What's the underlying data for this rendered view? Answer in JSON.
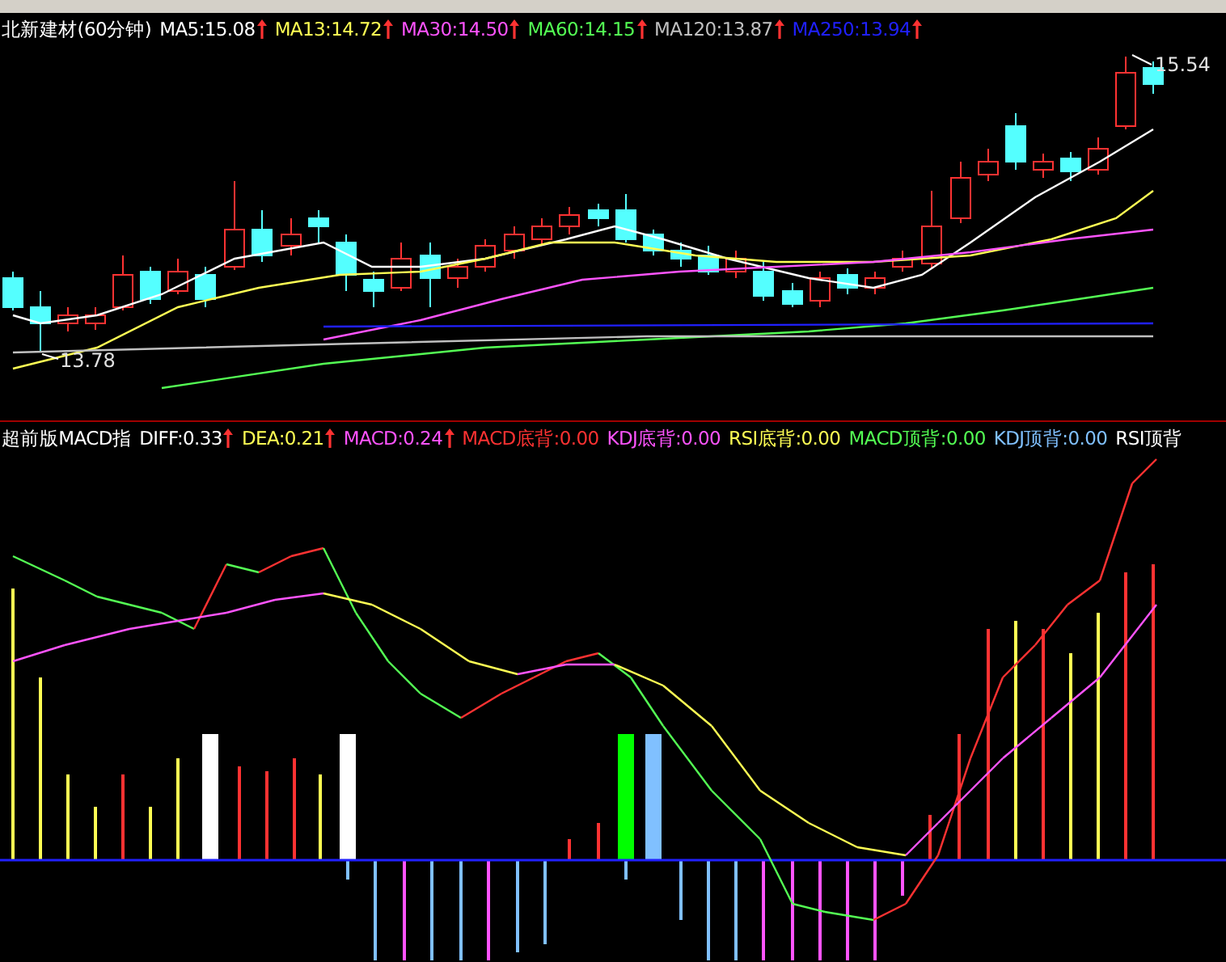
{
  "price_panel": {
    "title": "北新建材(60分钟)",
    "indicators": [
      {
        "label": "MA5:15.08",
        "color": "#ffffff",
        "arrow": true
      },
      {
        "label": "MA13:14.72",
        "color": "#ffff54",
        "arrow": true
      },
      {
        "label": "MA30:14.50",
        "color": "#ff54ff",
        "arrow": true
      },
      {
        "label": "MA60:14.15",
        "color": "#54ff54",
        "arrow": true
      },
      {
        "label": "MA120:13.87",
        "color": "#c0c0c0",
        "arrow": true
      },
      {
        "label": "MA250:13.94",
        "color": "#2020ff",
        "arrow": true
      }
    ],
    "high_label": "15.54",
    "low_label": "13.78"
  },
  "macd_panel": {
    "title": "超前版MACD指",
    "indicators": [
      {
        "label": "DIFF:0.33",
        "color": "#ffffff",
        "arrow": true
      },
      {
        "label": "DEA:0.21",
        "color": "#ffff54",
        "arrow": true
      },
      {
        "label": "MACD:0.24",
        "color": "#ff54ff",
        "arrow": true
      },
      {
        "label": "MACD底背:0.00",
        "color": "#ff3232",
        "arrow": false
      },
      {
        "label": "KDJ底背:0.00",
        "color": "#ff54ff",
        "arrow": false
      },
      {
        "label": "RSI底背:0.00",
        "color": "#ffff54",
        "arrow": false
      },
      {
        "label": "MACD顶背:0.00",
        "color": "#54ff54",
        "arrow": false
      },
      {
        "label": "KDJ顶背:0.00",
        "color": "#80c0ff",
        "arrow": false
      },
      {
        "label": "RSI顶背",
        "color": "#ffffff",
        "arrow": false
      }
    ]
  }
}
